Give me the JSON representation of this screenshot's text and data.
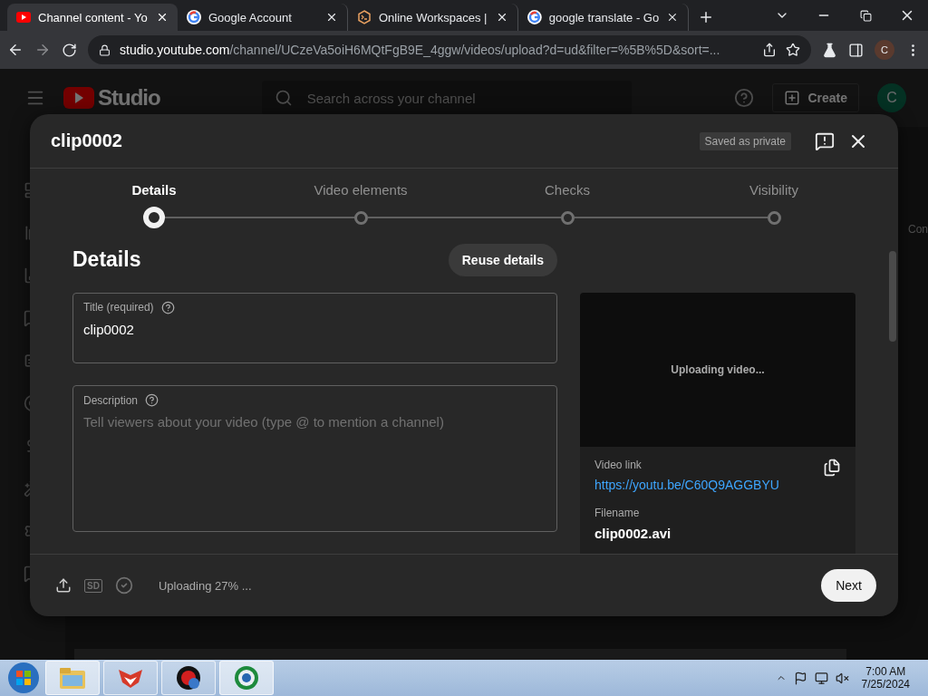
{
  "browser": {
    "tabs": [
      {
        "title": "Channel content - Yo",
        "selected": true,
        "kind": "youtube"
      },
      {
        "title": "Google Account",
        "selected": false,
        "kind": "google"
      },
      {
        "title": "Online Workspaces |",
        "selected": false,
        "kind": "hex"
      },
      {
        "title": "google translate - Go",
        "selected": false,
        "kind": "google"
      }
    ],
    "url_host": "studio.youtube.com",
    "url_path": "/channel/UCzeVa5oiH6MQtFgB9E_4ggw/videos/upload?d=ud&filter=%5B%5D&sort=...",
    "profile": "C"
  },
  "studio": {
    "logo": "Studio",
    "search_placeholder": "Search across your channel",
    "create": "Create",
    "avatar": "C",
    "side_text": "Con"
  },
  "dialog": {
    "title": "clip0002",
    "status": "Saved as private",
    "steps": [
      {
        "label": "Details",
        "selected": true
      },
      {
        "label": "Video elements",
        "selected": false
      },
      {
        "label": "Checks",
        "selected": false
      },
      {
        "label": "Visibility",
        "selected": false
      }
    ],
    "section_title": "Details",
    "reuse_button": "Reuse details",
    "title_field": {
      "label": "Title (required)",
      "value": "clip0002"
    },
    "description_field": {
      "label": "Description",
      "placeholder": "Tell viewers about your video (type @ to mention a channel)"
    },
    "preview": {
      "message": "Uploading video..."
    },
    "video_link": {
      "label": "Video link",
      "url": "https://youtu.be/C60Q9AGGBYU"
    },
    "filename": {
      "label": "Filename",
      "value": "clip0002.avi"
    },
    "footer": {
      "quality": "SD",
      "status": "Uploading 27% ...",
      "next": "Next"
    }
  },
  "taskbar": {
    "time": "7:00 AM",
    "date": "7/25/2024"
  }
}
